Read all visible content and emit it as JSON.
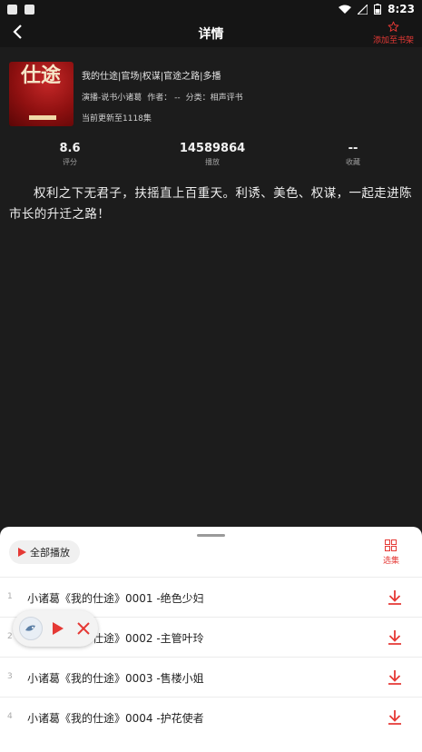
{
  "status_bar": {
    "time": "8:23",
    "icons": [
      "shield-icon",
      "a-icon",
      "wifi-icon",
      "signal-icon",
      "battery-icon"
    ]
  },
  "app_bar": {
    "title": "详情",
    "add_shelf_label": "添加至书架",
    "accent": "#e53935"
  },
  "book": {
    "title": "我的仕途|官场|权谋|官途之路|多播",
    "narrator": "演播-说书小诸葛",
    "author": "作者： --",
    "category": "分类：相声评书",
    "update": "当前更新至1118集",
    "cover_text": "仕途"
  },
  "stats": [
    {
      "value": "8.6",
      "label": "评分"
    },
    {
      "value": "14589864",
      "label": "播放"
    },
    {
      "value": "--",
      "label": "收藏"
    }
  ],
  "description": "权利之下无君子，扶摇直上百重天。利诱、美色、权谋，一起走进陈市长的升迁之路！",
  "sheet": {
    "play_all_label": "全部播放",
    "select_label": "选集",
    "episodes": [
      {
        "num": "1",
        "name": "小诸葛《我的仕途》0001 -绝色少妇"
      },
      {
        "num": "2",
        "name": "小诸葛《我的仕途》0002 -主管叶玲"
      },
      {
        "num": "3",
        "name": "小诸葛《我的仕途》0003 -售楼小姐"
      },
      {
        "num": "4",
        "name": "小诸葛《我的仕途》0004 -护花使者"
      }
    ]
  }
}
